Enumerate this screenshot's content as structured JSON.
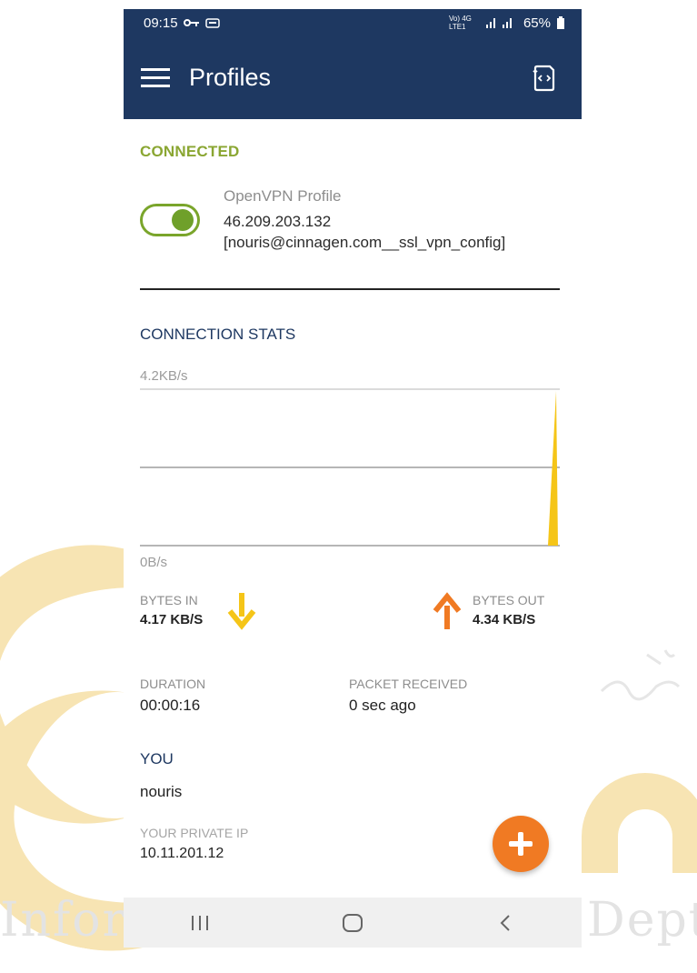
{
  "status_bar": {
    "time": "09:15",
    "network_text": "Vo) 4G LTE1",
    "battery": "65%"
  },
  "app_bar": {
    "title": "Profiles",
    "menu_icon": "hamburger-menu-icon",
    "action_icon": "import-profile-icon"
  },
  "connected_section": {
    "header": "CONNECTED",
    "profile_name": "OpenVPN Profile",
    "profile_detail": "46.209.203.132 [nouris@cinnagen.com__ssl_vpn_config]",
    "toggle_on": true
  },
  "stats": {
    "header": "CONNECTION STATS",
    "max_label": "4.2KB/s",
    "min_label": "0B/s",
    "bytes_in_label": "BYTES IN",
    "bytes_in_value": "4.17 KB/S",
    "bytes_out_label": "BYTES OUT",
    "bytes_out_value": "4.34 KB/S",
    "duration_label": "DURATION",
    "duration_value": "00:00:16",
    "packet_label": "PACKET RECEIVED",
    "packet_value": "0 sec ago"
  },
  "you": {
    "header": "YOU",
    "username": "nouris",
    "private_ip_label": "YOUR PRIVATE IP",
    "private_ip": "10.11.201.12"
  },
  "watermark": {
    "left": "Infor",
    "right": "Dept"
  },
  "colors": {
    "primary": "#1e3861",
    "accent_green": "#8aa632",
    "in_arrow": "#f5c518",
    "out_arrow": "#f07a23",
    "fab": "#f07a23"
  }
}
